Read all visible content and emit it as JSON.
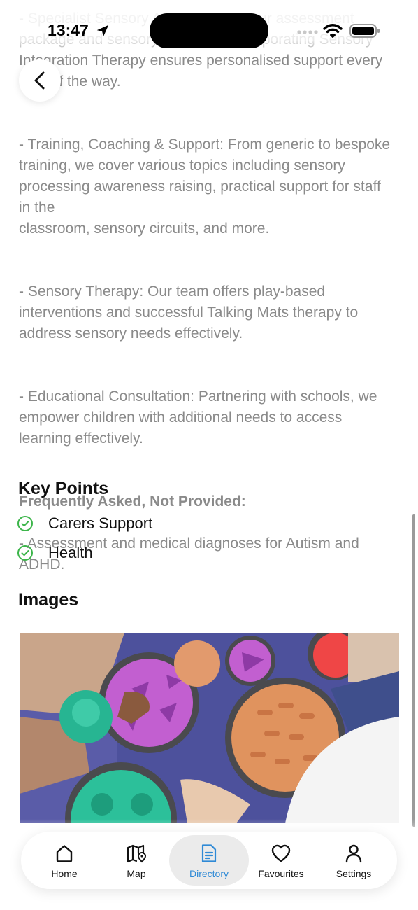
{
  "description": {
    "paragraphs": [
      "- Specialist Sensory Assessments: Our assessment package and sensory strategies incorporating Sensory Integration Therapy ensures personalised support every step of the way.",
      "- Training, Coaching & Support: From generic to bespoke training, we cover various topics including sensory processing awareness raising, practical support for staff in the\nclassroom, sensory circuits, and more.",
      "- Sensory Therapy: Our team offers play-based interventions and successful Talking Mats therapy to address sensory needs effectively.",
      "- Educational Consultation: Partnering with schools, we empower children with additional needs to access learning effectively."
    ],
    "faq_heading": "Frequently Asked, Not Provided:",
    "faq_text": "- Assessment and medical diagnoses for Autism and ADHD."
  },
  "key_points": {
    "title": "Key Points",
    "items": [
      {
        "label": "Carers Support",
        "icon": "check-circle-icon"
      },
      {
        "label": "Health",
        "icon": "check-circle-icon"
      }
    ],
    "check_color": "#3cb54a"
  },
  "images": {
    "title": "Images"
  },
  "status_bar": {
    "time": "13:47"
  },
  "tab_bar": {
    "active_color": "#2f8ad6",
    "tabs": [
      {
        "label": "Home",
        "icon": "home-icon"
      },
      {
        "label": "Map",
        "icon": "map-icon"
      },
      {
        "label": "Directory",
        "icon": "directory-icon"
      },
      {
        "label": "Favourites",
        "icon": "heart-icon"
      },
      {
        "label": "Settings",
        "icon": "person-icon"
      }
    ],
    "active_index": 2
  }
}
